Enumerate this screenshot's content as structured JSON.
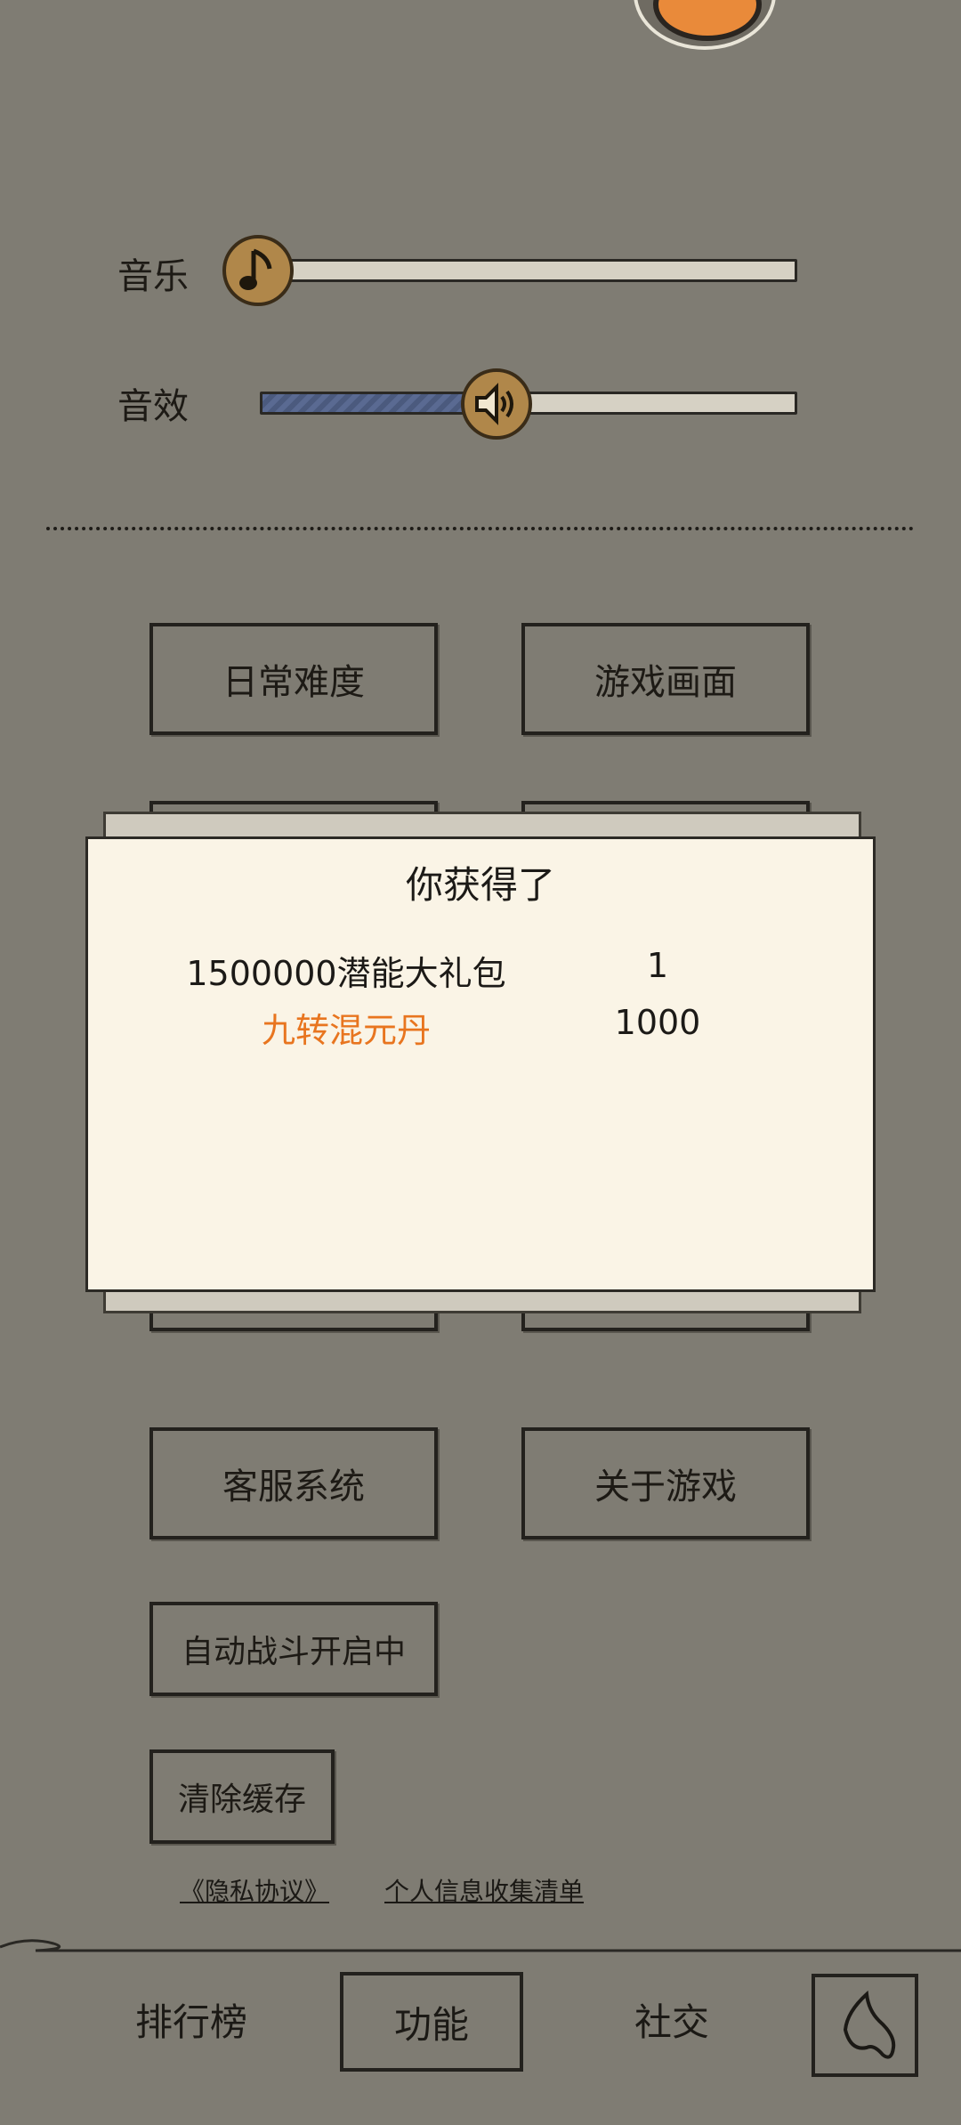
{
  "settings": {
    "music_label": "音乐",
    "music_volume": 0,
    "sfx_label": "音效",
    "sfx_volume": 0.44
  },
  "buttons": {
    "daily_difficulty": "日常难度",
    "game_graphics": "游戏画面",
    "customer_service": "客服系统",
    "about_game": "关于游戏",
    "auto_battle": "自动战斗开启中",
    "clear_cache": "清除缓存"
  },
  "dialog": {
    "title": "你获得了",
    "rewards": [
      {
        "name": "1500000潜能大礼包",
        "qty": "1",
        "color": "#1c1a17"
      },
      {
        "name": "九转混元丹",
        "qty": "1000",
        "color": "#e8751f"
      }
    ]
  },
  "links": {
    "privacy": "《隐私协议》",
    "info_list": "个人信息收集清单"
  },
  "nav": {
    "ranking": "排行榜",
    "functions": "功能",
    "social": "社交"
  },
  "colors": {
    "background": "#7f7c73",
    "dialog_bg": "#faf4e6",
    "knob": "#b0874a",
    "slider_fill": "#5a6a92",
    "highlight_text": "#e8751f"
  }
}
